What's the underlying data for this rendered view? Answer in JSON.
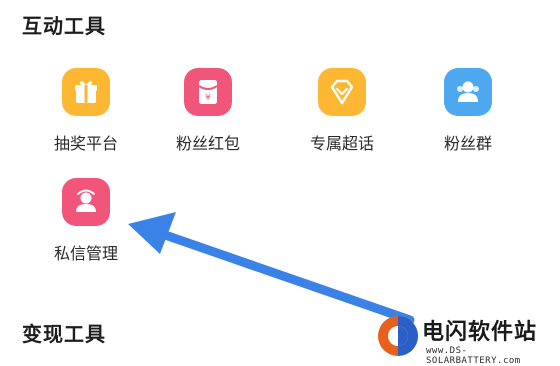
{
  "sections": {
    "interactive_tools_title": "互动工具",
    "monetize_tools_title": "变现工具"
  },
  "tools": [
    {
      "label": "抽奖平台",
      "icon": "gift-icon",
      "color": "#FDB733"
    },
    {
      "label": "粉丝红包",
      "icon": "red-envelope-icon",
      "color": "#F2557A"
    },
    {
      "label": "专属超话",
      "icon": "diamond-icon",
      "color": "#FDB733"
    },
    {
      "label": "粉丝群",
      "icon": "fans-group-icon",
      "color": "#4DA8F0"
    },
    {
      "label": "私信管理",
      "icon": "message-management-icon",
      "color": "#F2557A"
    }
  ],
  "annotation": {
    "icon": "arrow-pointer-icon",
    "color": "#3B82E6"
  },
  "watermark": {
    "name": "电闪软件站",
    "url": "www.DS-SOLARBATTERY.com"
  }
}
